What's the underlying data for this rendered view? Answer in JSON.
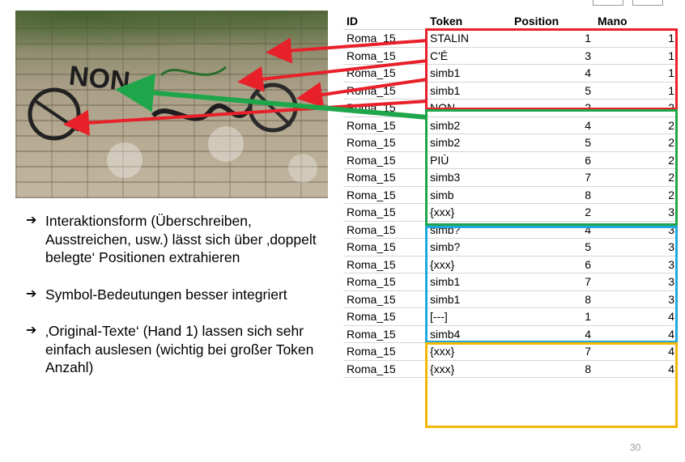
{
  "table": {
    "headers": [
      "ID",
      "Token",
      "Position",
      "Mano"
    ],
    "rows": [
      [
        "Roma_15",
        "STALIN",
        "1",
        "1"
      ],
      [
        "Roma_15",
        "C'É",
        "3",
        "1"
      ],
      [
        "Roma_15",
        "simb1",
        "4",
        "1"
      ],
      [
        "Roma_15",
        "simb1",
        "5",
        "1"
      ],
      [
        "Roma_15",
        "NON",
        "2",
        "2"
      ],
      [
        "Roma_15",
        "simb2",
        "4",
        "2"
      ],
      [
        "Roma_15",
        "simb2",
        "5",
        "2"
      ],
      [
        "Roma_15",
        "PIÙ",
        "6",
        "2"
      ],
      [
        "Roma_15",
        "simb3",
        "7",
        "2"
      ],
      [
        "Roma_15",
        "simb",
        "8",
        "2"
      ],
      [
        "Roma_15",
        "{xxx}",
        "2",
        "3"
      ],
      [
        "Roma_15",
        "simb?",
        "4",
        "3"
      ],
      [
        "Roma_15",
        "simb?",
        "5",
        "3"
      ],
      [
        "Roma_15",
        "{xxx}",
        "6",
        "3"
      ],
      [
        "Roma_15",
        "simb1",
        "7",
        "3"
      ],
      [
        "Roma_15",
        "simb1",
        "8",
        "3"
      ],
      [
        "Roma_15",
        "[---]",
        "1",
        "4"
      ],
      [
        "Roma_15",
        "simb4",
        "4",
        "4"
      ],
      [
        "Roma_15",
        "{xxx}",
        "7",
        "4"
      ],
      [
        "Roma_15",
        "{xxx}",
        "8",
        "4"
      ]
    ]
  },
  "bullets": {
    "arrow_glyph": "➔",
    "items": [
      "Interaktionsform (Überschreiben, Ausstreichen, usw.) lässt sich über ‚doppelt belegte‘ Positionen extrahieren",
      "Symbol-Bedeutungen besser integriert",
      "‚Original-Texte‘ (Hand 1) lassen sich sehr einfach auslesen (wichtig bei großer Token Anzahl)"
    ]
  },
  "page_number": "30",
  "photo": {
    "graffiti_text": "NON"
  },
  "colors": {
    "hand1": "#e8202a",
    "hand2": "#1fa64a",
    "hand3": "#1fa8e0",
    "hand4": "#f2b705"
  }
}
